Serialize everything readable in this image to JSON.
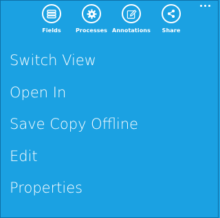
{
  "colors": {
    "background": "#1ba1e2",
    "foreground": "#ffffff"
  },
  "app_bar": {
    "buttons": [
      {
        "label": "Fields",
        "icon": "fields-icon"
      },
      {
        "label": "Processes",
        "icon": "gear-icon"
      },
      {
        "label": "Annotations",
        "icon": "pen-icon"
      },
      {
        "label": "Share",
        "icon": "share-icon"
      }
    ],
    "more_icon": "ellipsis-icon"
  },
  "menu": {
    "items": [
      {
        "label": "Switch View"
      },
      {
        "label": "Open In"
      },
      {
        "label": "Save Copy Offline"
      },
      {
        "label": "Edit"
      },
      {
        "label": "Properties"
      }
    ]
  }
}
